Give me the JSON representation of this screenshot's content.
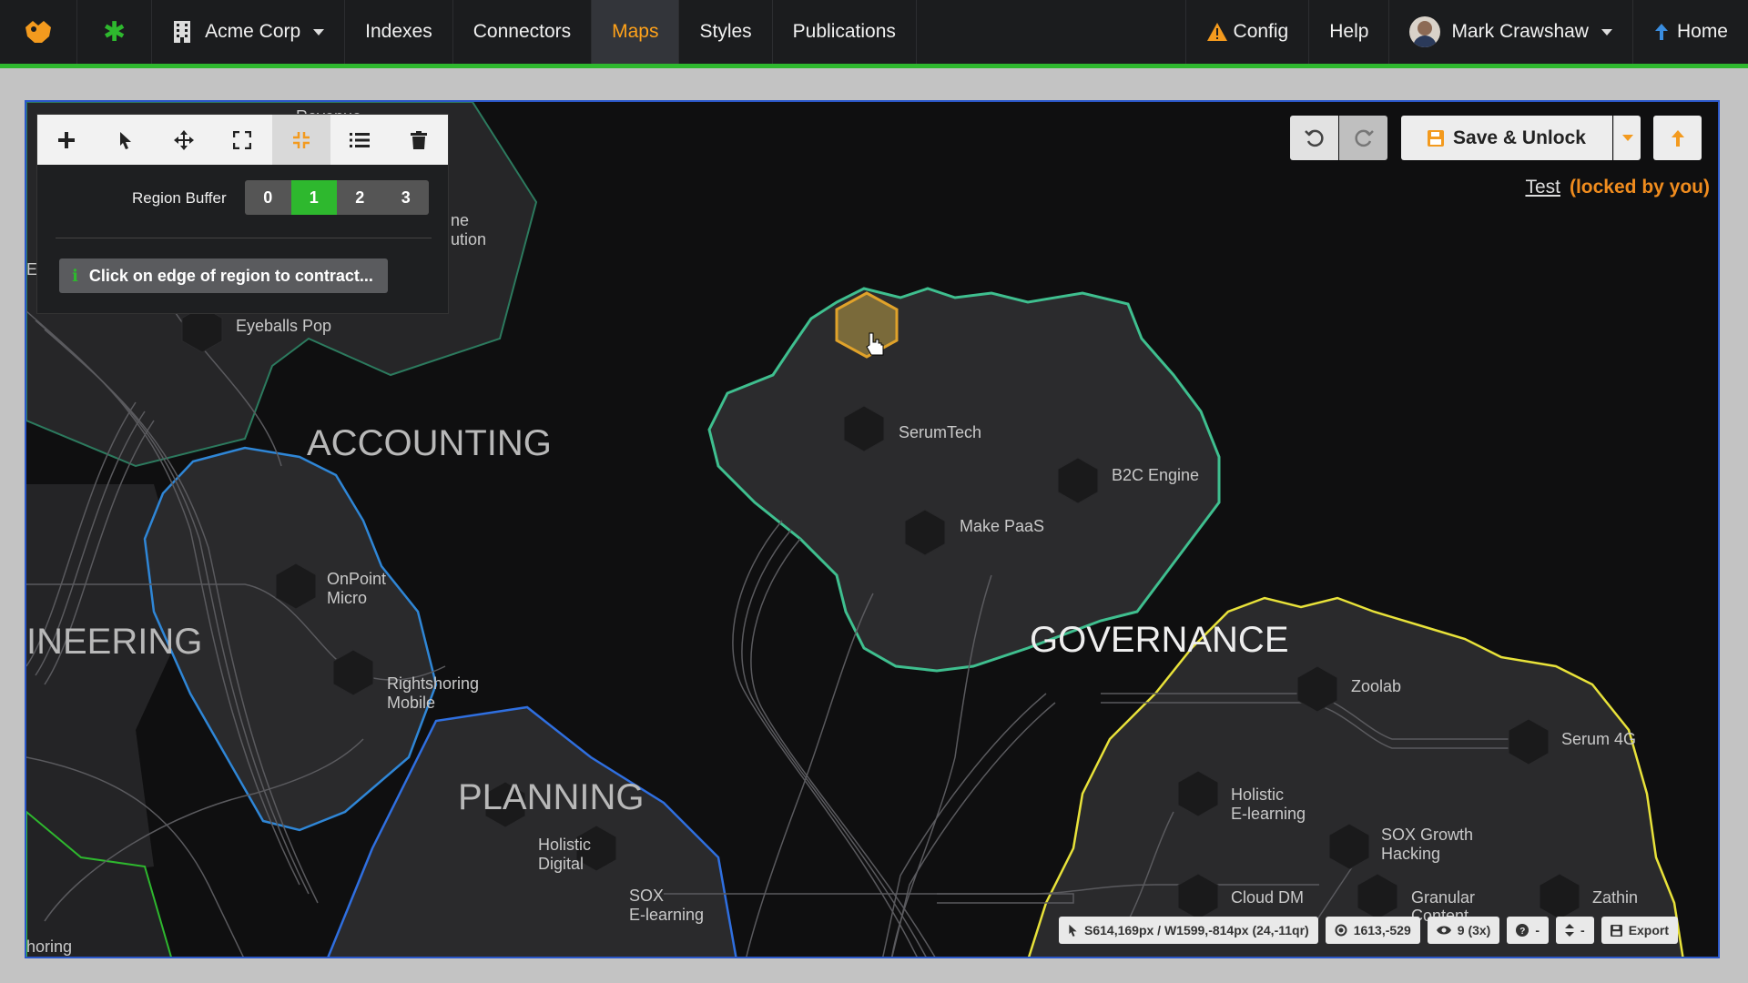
{
  "nav": {
    "org": "Acme Corp",
    "items": [
      "Indexes",
      "Connectors",
      "Maps",
      "Styles",
      "Publications"
    ],
    "active": "Maps",
    "config": "Config",
    "help": "Help",
    "user": "Mark Crawshaw",
    "home": "Home"
  },
  "toolpanel": {
    "tools": [
      "add-icon",
      "pointer-icon",
      "move-icon",
      "expand-icon",
      "contract-icon",
      "list-icon",
      "trash-icon"
    ],
    "active_tool": "contract-icon",
    "buffer_label": "Region Buffer",
    "buffer_options": [
      "0",
      "1",
      "2",
      "3"
    ],
    "buffer_selected": "1",
    "hint": "Click on edge of region to contract..."
  },
  "controls": {
    "save_label": "Save & Unlock",
    "lock_name": "Test",
    "lock_status": "(locked by you)"
  },
  "regions": {
    "accounting": "ACCOUNTING",
    "engineering": "INEERING",
    "governance": "GOVERNANCE",
    "planning": "PLANNING"
  },
  "nodes": {
    "serumtech": "SerumTech",
    "b2c": "B2C Engine",
    "makepaas": "Make PaaS",
    "onpoint1": "OnPoint",
    "onpoint2": "Micro",
    "rightshoring1": "Rightshoring",
    "rightshoring2": "Mobile",
    "eyeballs": "Eyeballs Pop",
    "holdig1": "Holistic",
    "holdig2": "Digital",
    "soxel1": "SOX",
    "soxel2": "E-learning",
    "zoolab": "Zoolab",
    "serum4g": "Serum 4G",
    "holel1": "Holistic",
    "holel2": "E-learning",
    "soxgh1": "SOX Growth",
    "soxgh2": "Hacking",
    "clouddm": "Cloud DM",
    "granular1": "Granular",
    "granular2": "Content",
    "zathin": "Zathin",
    "partial_reve": "Revenue",
    "partial_ne": "ne",
    "partial_ution": "ution",
    "partial_e": "E",
    "partial_horing": "horing"
  },
  "statusbar": {
    "cursor": "S614,169px / W1599,-814px (24,-11qr)",
    "coords": "1613,-529",
    "view": "9 (3x)",
    "help": "-",
    "sort": "-",
    "export": "Export"
  }
}
